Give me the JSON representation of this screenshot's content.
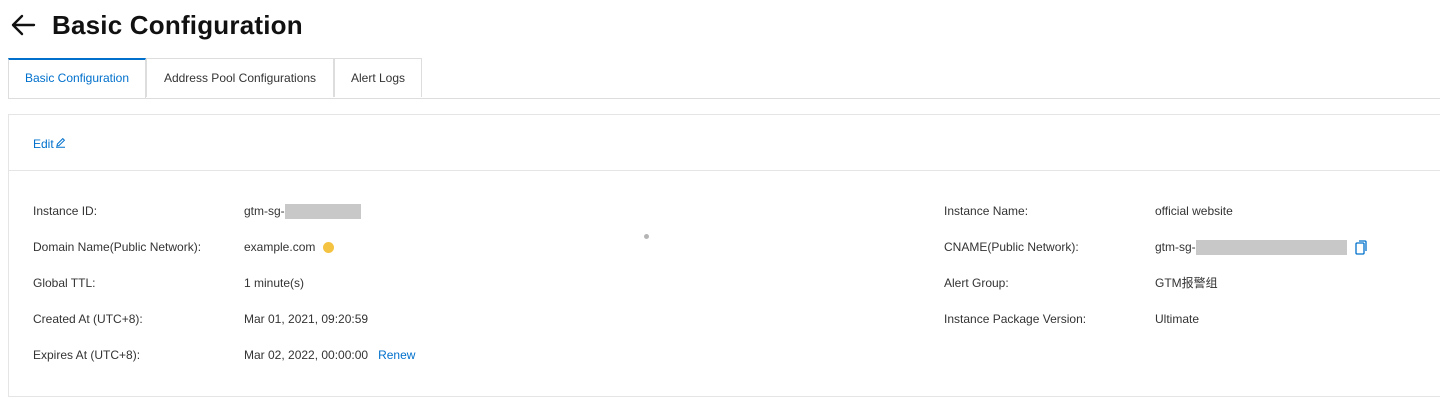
{
  "header": {
    "title": "Basic Configuration",
    "back_icon": "arrow-left-icon"
  },
  "tabs": [
    {
      "label": "Basic Configuration",
      "active": true
    },
    {
      "label": "Address Pool Configurations",
      "active": false
    },
    {
      "label": "Alert Logs",
      "active": false
    }
  ],
  "edit": {
    "label": "Edit",
    "icon": "pencil-icon"
  },
  "details": {
    "instance_id": {
      "label": "Instance ID:",
      "value": "gtm-sg-"
    },
    "domain_name": {
      "label": "Domain Name(Public Network):",
      "value": "example.com",
      "status_color": "#f5c342"
    },
    "global_ttl": {
      "label": "Global TTL:",
      "value": "1 minute(s)"
    },
    "created_at": {
      "label": "Created At (UTC+8):",
      "value": "Mar 01, 2021, 09:20:59"
    },
    "expires_at": {
      "label": "Expires At (UTC+8):",
      "value": "Mar 02, 2022, 00:00:00",
      "action": "Renew"
    },
    "instance_name": {
      "label": "Instance Name:",
      "value": "official website"
    },
    "cname": {
      "label": "CNAME(Public Network):",
      "value": "gtm-sg-",
      "icon": "copy-icon"
    },
    "alert_group": {
      "label": "Alert Group:",
      "value": "GTM报警组"
    },
    "package_version": {
      "label": "Instance Package Version:",
      "value": "Ultimate"
    }
  },
  "colors": {
    "accent": "#0070cc",
    "border": "#dddddd",
    "mask": "#c8c8c8"
  }
}
